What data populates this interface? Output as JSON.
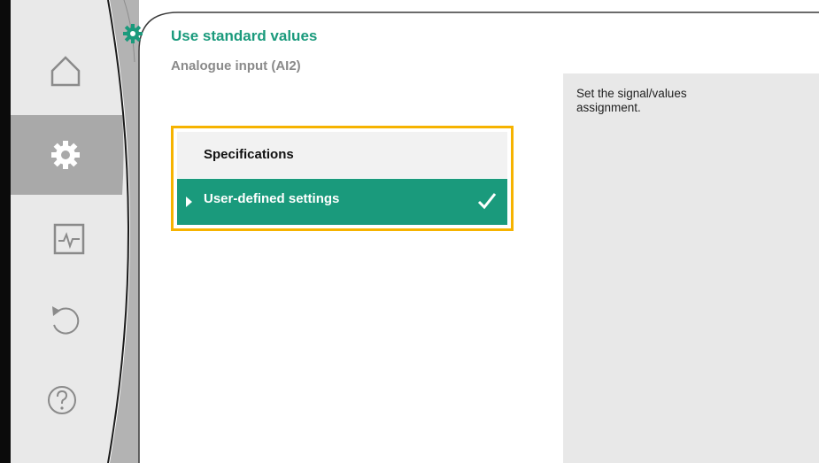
{
  "header": {
    "title": "Use standard values",
    "subtitle": "Analogue input (AI2)"
  },
  "help": {
    "text": "Set the signal/values assignment."
  },
  "menu": {
    "items": [
      {
        "label": "Specifications",
        "selected": false,
        "focused": false
      },
      {
        "label": "User-defined settings",
        "selected": true,
        "focused": true
      }
    ]
  },
  "nav": {
    "items": [
      {
        "icon": "home-icon",
        "active": false
      },
      {
        "icon": "gear-icon",
        "active": true
      },
      {
        "icon": "monitor-icon",
        "active": false
      },
      {
        "icon": "restore-icon",
        "active": false
      },
      {
        "icon": "help-icon",
        "active": false
      }
    ]
  },
  "colors": {
    "accent": "#1a9a7c",
    "focus_border": "#f6b300",
    "nav_bg": "#e9e9e9",
    "nav_active": "#a9a9a9",
    "help_bg": "#e8e8e8"
  }
}
